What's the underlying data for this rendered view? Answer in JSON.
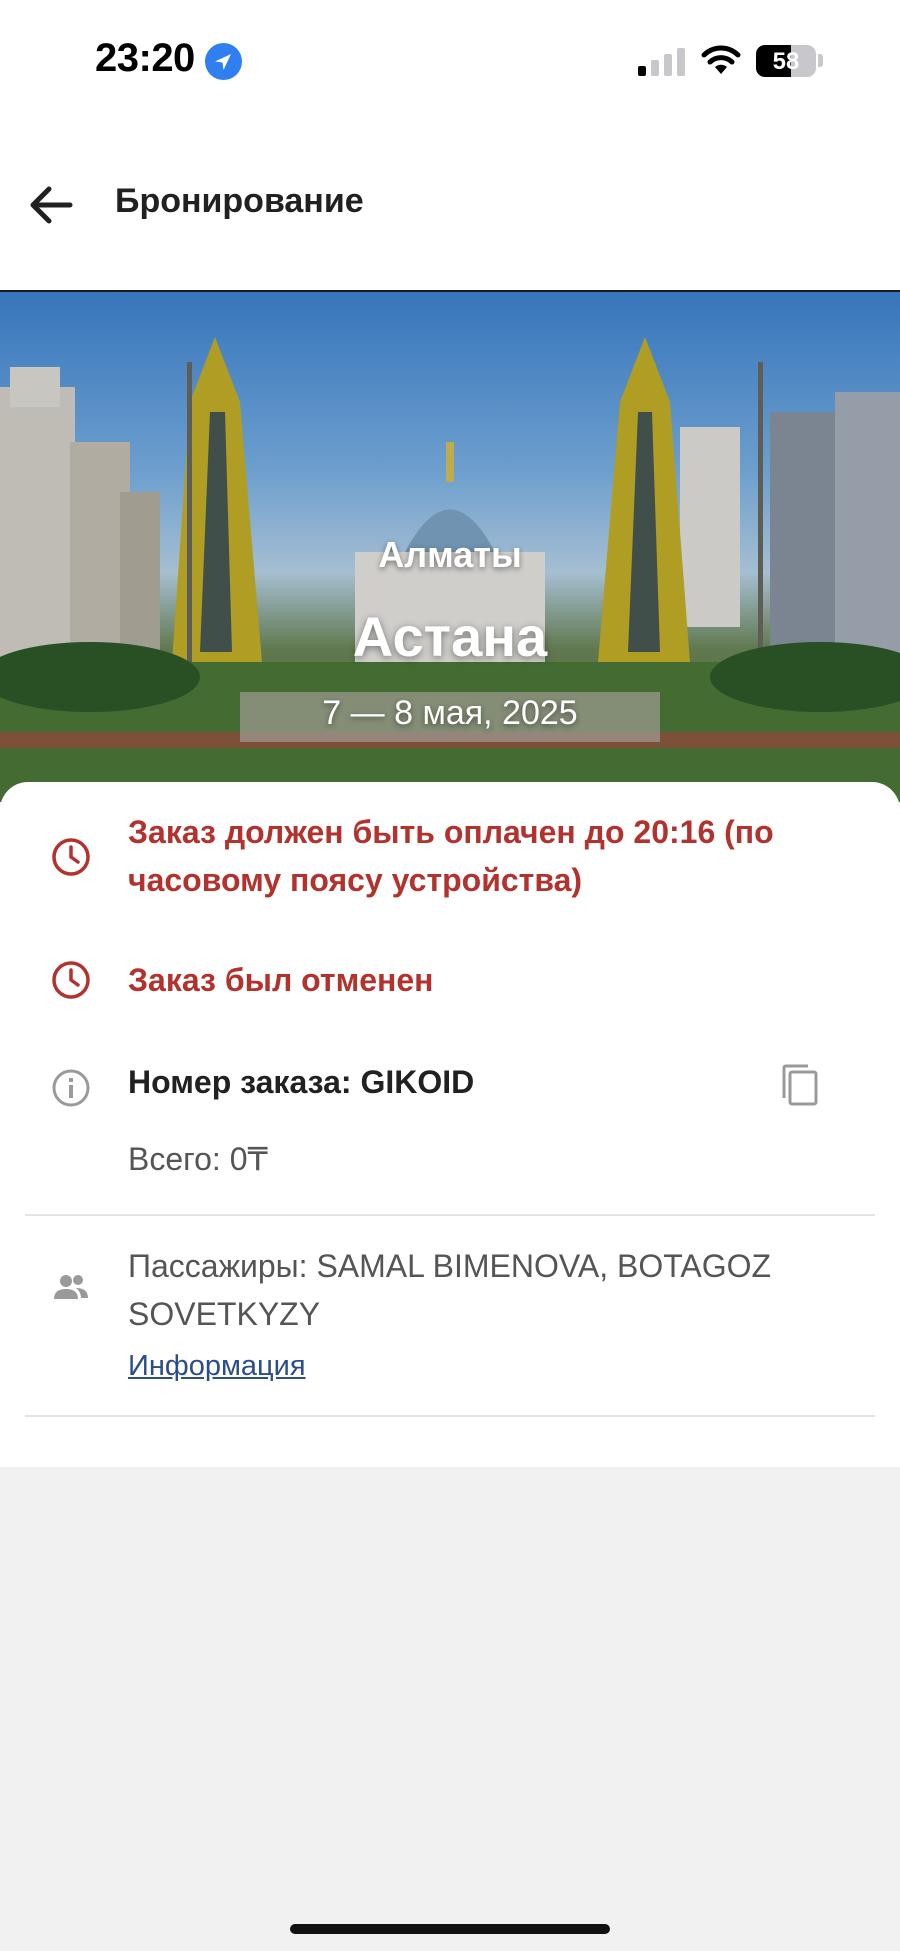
{
  "status_bar": {
    "time": "23:20",
    "battery_percent": "58",
    "battery_level": 0.58,
    "icons": [
      "location-arrow-icon",
      "cellular-signal-icon",
      "wifi-icon",
      "battery-icon"
    ]
  },
  "app_bar": {
    "title": "Бронирование",
    "back_icon": "arrow-left-icon"
  },
  "trip": {
    "from": "Алматы",
    "to": "Астана",
    "dates": "7 — 8 мая, 2025"
  },
  "booking": {
    "payment_deadline": "Заказ должен быть оплачен до 20:16 (по часовому поясу устройства)",
    "cancel_status": "Заказ был отменен",
    "order_number": "Номер заказа: GIKOID",
    "total": "Всего: 0₸",
    "passengers": "Пассажиры: SAMAL BIMENOVA, BOTAGOZ SOVETKYZY",
    "info_link": "Информация"
  },
  "colors": {
    "warning": "#b3322e",
    "link": "#2b4d8c",
    "location_badge": "#2f7ff0"
  }
}
